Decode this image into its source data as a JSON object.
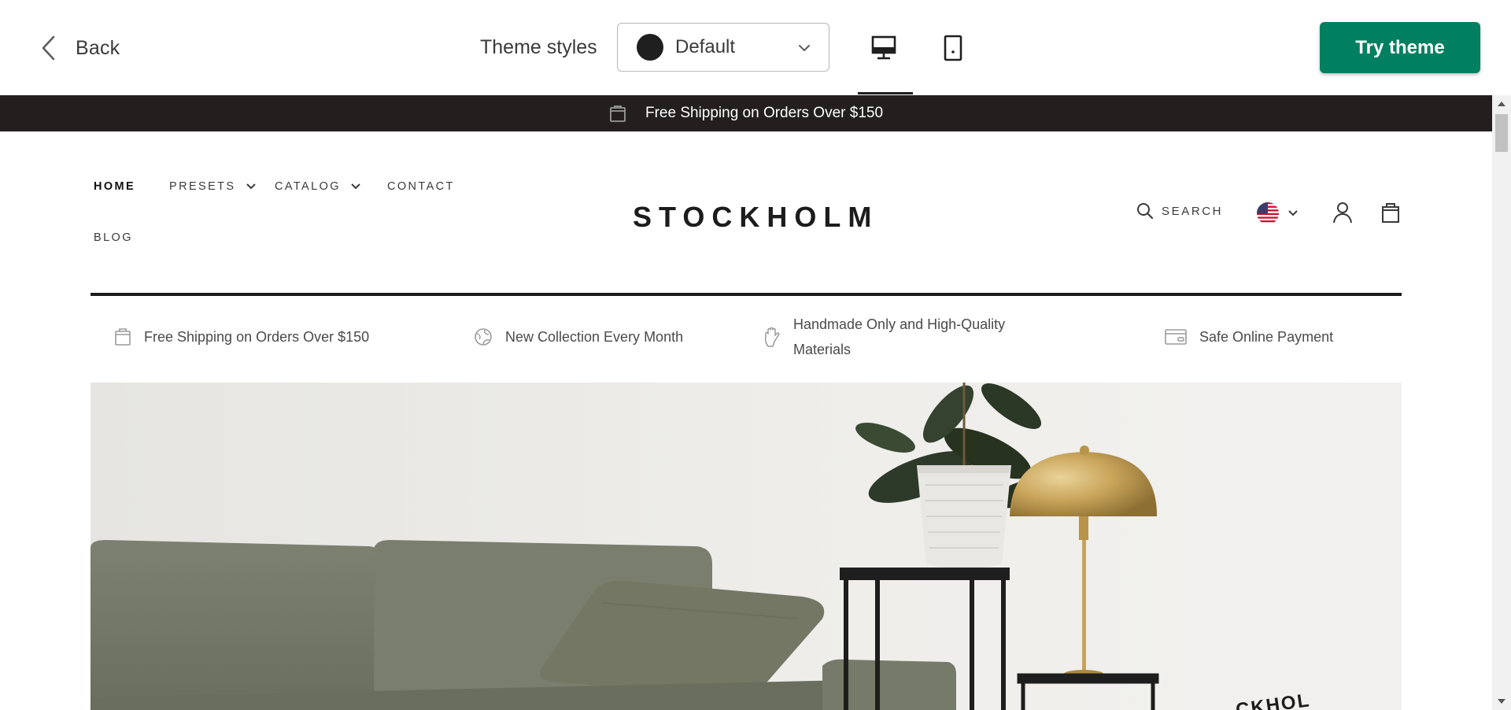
{
  "toolbar": {
    "back_label": "Back",
    "theme_styles_label": "Theme styles",
    "theme_style_selected": "Default",
    "theme_style_swatch_color": "#1f1f1f",
    "desktop_view_icon": "desktop-icon",
    "mobile_view_icon": "mobile-icon",
    "try_theme_label": "Try theme",
    "accent_color": "#008060"
  },
  "store": {
    "announcement": "Free Shipping on Orders Over $150",
    "logo": "STOCKHOLM",
    "nav": [
      {
        "label": "HOME",
        "active": true
      },
      {
        "label": "PRESETS",
        "has_dropdown": true
      },
      {
        "label": "CATALOG",
        "has_dropdown": true
      },
      {
        "label": "CONTACT"
      },
      {
        "label": "BLOG"
      }
    ],
    "search_label": "SEARCH",
    "features": [
      {
        "icon": "bag-icon",
        "text": "Free Shipping on Orders Over $150"
      },
      {
        "icon": "globe-icon",
        "text": "New Collection Every Month"
      },
      {
        "icon": "hand-icon",
        "text": "Handmade Only and High-Quality Materials"
      },
      {
        "icon": "card-icon",
        "text": "Safe Online Payment"
      }
    ],
    "hero_badge_text": "CKHOL"
  }
}
